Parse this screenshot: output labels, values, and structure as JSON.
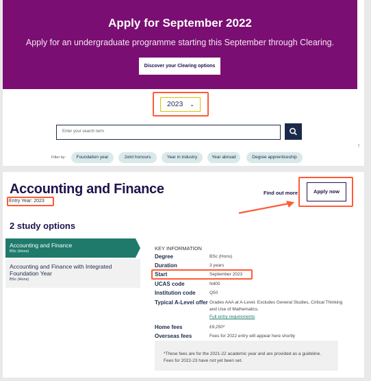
{
  "banner": {
    "title": "Apply for September 2022",
    "subtitle": "Apply for an undergraduate programme starting this September through Clearing.",
    "button_label": "Discover your Clearing options",
    "bg_color": "#7b0e72"
  },
  "year_select": {
    "value": "2023",
    "icon": "chevron-down-icon"
  },
  "search": {
    "placeholder": "Enter your search term",
    "button_icon": "search-icon"
  },
  "filters": {
    "label": "Filter by:",
    "chips": [
      "Foundation year",
      "Joint honours",
      "Year in industry",
      "Year abroad",
      "Degree apprenticeship"
    ]
  },
  "course": {
    "title": "Accounting and Finance",
    "entry_year": "Entry Year: 2023",
    "find_out_more": "Find out more",
    "apply_now": "Apply now"
  },
  "study_options": {
    "heading": "2 study options",
    "options": [
      {
        "name": "Accounting and Finance",
        "sub": "BSc (Hons)",
        "active": true
      },
      {
        "name": "Accounting and Finance with Integrated Foundation Year",
        "sub": "BSc (Hons)",
        "active": false
      }
    ]
  },
  "key_info": {
    "heading": "KEY INFORMATION",
    "rows": [
      {
        "label": "Degree",
        "value": "BSc (Hons)"
      },
      {
        "label": "Duration",
        "value": "3 years"
      },
      {
        "label": "Start",
        "value": "September 2023"
      },
      {
        "label": "UCAS code",
        "value": "N400"
      },
      {
        "label": "Institution code",
        "value": "Q50"
      },
      {
        "label": "Typical A-Level offer",
        "value": "Grades AAA at A-Level. Excludes General Studies, Critical Thinking and Use of Mathematics."
      },
      {
        "label": "Home fees",
        "value": "£9,250*"
      },
      {
        "label": "Overseas fees",
        "value": "Fees for 2022 entry will appear here shortly"
      }
    ],
    "entry_link": "Full entry requirements",
    "note": "*These fees are for the 2021-22 academic year and are provided as a guideline. Fees for 2022-23 have not yet been set."
  },
  "colors": {
    "accent": "#1f7a6b",
    "navy": "#20124d",
    "highlight": "#ff5a36"
  }
}
